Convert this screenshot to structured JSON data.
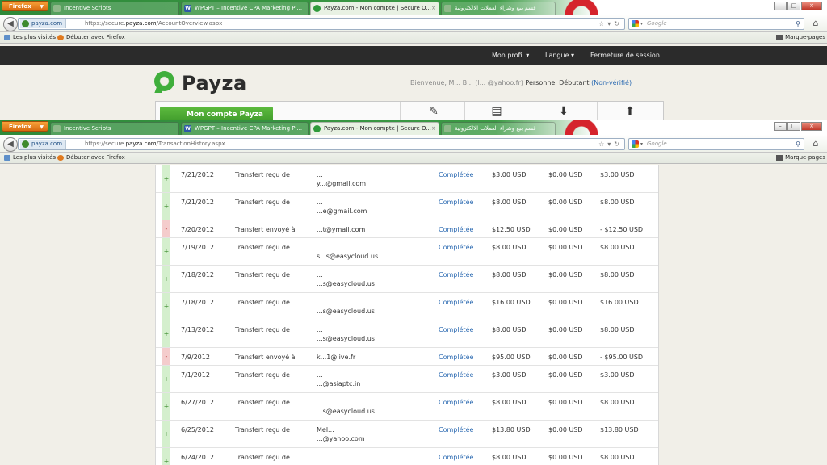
{
  "window1": {
    "browser": {
      "firefox_label": "Firefox",
      "tabs": [
        {
          "label": "Incentive Scripts"
        },
        {
          "label": "WPGPT – Incentive CPA Marketing Pl..."
        },
        {
          "label": "Payza.com - Mon compte | Secure O..."
        },
        {
          "label": "قسم بيع وشراء العملات الالكترونية"
        }
      ],
      "url_site": "payza.com",
      "url_prefix": "https://secure.",
      "url_domain": "payza.com",
      "url_path": "/AccountOverview.aspx",
      "search_placeholder": "Google",
      "bookmarks": [
        "Les plus visités",
        "Débuter avec Firefox"
      ],
      "bookmarks_right": "Marque-pages"
    },
    "topnav": {
      "profile": "Mon profil ▾",
      "language": "Langue ▾",
      "logout": "Fermeture de session"
    },
    "brand": "Payza",
    "welcome": {
      "prefix": "Bienvenue, M... B... (l... @yahoo.fr)",
      "status": " Personnel Débutant ",
      "verify": "(Non-vérifié)"
    },
    "menu": {
      "active": "Mon compte Payza",
      "active_icon": "+"
    }
  },
  "window2": {
    "browser": {
      "firefox_label": "Firefox",
      "tabs": [
        {
          "label": "Incentive Scripts"
        },
        {
          "label": "WPGPT – Incentive CPA Marketing Pl..."
        },
        {
          "label": "Payza.com - Mon compte | Secure O..."
        },
        {
          "label": "قسم بيع وشراء العملات الالكترونية"
        }
      ],
      "url_site": "payza.com",
      "url_prefix": "https://secure.",
      "url_domain": "payza.com",
      "url_path": "/TransactionHistory.aspx",
      "search_placeholder": "Google",
      "bookmarks": [
        "Les plus visités",
        "Débuter avec Firefox"
      ],
      "bookmarks_right": "Marque-pages"
    },
    "transactions": [
      {
        "sign": "+",
        "date": "7/21/2012",
        "type": "Transfert reçu de",
        "who1": "...",
        "who2": "y...@gmail.com",
        "status": "Complétée",
        "amount": "$3.00 USD",
        "fee": "$0.00 USD",
        "net": "$3.00 USD"
      },
      {
        "sign": "+",
        "date": "7/21/2012",
        "type": "Transfert reçu de",
        "who1": "...",
        "who2": "...e@gmail.com",
        "status": "Complétée",
        "amount": "$8.00 USD",
        "fee": "$0.00 USD",
        "net": "$8.00 USD"
      },
      {
        "sign": "-",
        "date": "7/20/2012",
        "type": "Transfert envoyé à",
        "who1": "...t@ymail.com",
        "who2": "",
        "status": "Complétée",
        "amount": "$12.50 USD",
        "fee": "$0.00 USD",
        "net": "- $12.50 USD"
      },
      {
        "sign": "+",
        "date": "7/19/2012",
        "type": "Transfert reçu de",
        "who1": "...",
        "who2": "s...s@easycloud.us",
        "status": "Complétée",
        "amount": "$8.00 USD",
        "fee": "$0.00 USD",
        "net": "$8.00 USD"
      },
      {
        "sign": "+",
        "date": "7/18/2012",
        "type": "Transfert reçu de",
        "who1": "...",
        "who2": "...s@easycloud.us",
        "status": "Complétée",
        "amount": "$8.00 USD",
        "fee": "$0.00 USD",
        "net": "$8.00 USD"
      },
      {
        "sign": "+",
        "date": "7/18/2012",
        "type": "Transfert reçu de",
        "who1": "...",
        "who2": "...s@easycloud.us",
        "status": "Complétée",
        "amount": "$16.00 USD",
        "fee": "$0.00 USD",
        "net": "$16.00 USD"
      },
      {
        "sign": "+",
        "date": "7/13/2012",
        "type": "Transfert reçu de",
        "who1": "...",
        "who2": "...s@easycloud.us",
        "status": "Complétée",
        "amount": "$8.00 USD",
        "fee": "$0.00 USD",
        "net": "$8.00 USD"
      },
      {
        "sign": "-",
        "date": "7/9/2012",
        "type": "Transfert envoyé à",
        "who1": "k...1@live.fr",
        "who2": "",
        "status": "Complétée",
        "amount": "$95.00 USD",
        "fee": "$0.00 USD",
        "net": "- $95.00 USD"
      },
      {
        "sign": "+",
        "date": "7/1/2012",
        "type": "Transfert reçu de",
        "who1": "...",
        "who2": "...@asiaptc.in",
        "status": "Complétée",
        "amount": "$3.00 USD",
        "fee": "$0.00 USD",
        "net": "$3.00 USD"
      },
      {
        "sign": "+",
        "date": "6/27/2012",
        "type": "Transfert reçu de",
        "who1": "...",
        "who2": "...s@easycloud.us",
        "status": "Complétée",
        "amount": "$8.00 USD",
        "fee": "$0.00 USD",
        "net": "$8.00 USD"
      },
      {
        "sign": "+",
        "date": "6/25/2012",
        "type": "Transfert reçu de",
        "who1": "Mel...",
        "who2": "...@yahoo.com",
        "status": "Complétée",
        "amount": "$13.80 USD",
        "fee": "$0.00 USD",
        "net": "$13.80 USD"
      },
      {
        "sign": "+",
        "date": "6/24/2012",
        "type": "Transfert reçu de",
        "who1": "...",
        "who2": "",
        "status": "Complétée",
        "amount": "$8.00 USD",
        "fee": "$0.00 USD",
        "net": "$8.00 USD"
      }
    ]
  }
}
